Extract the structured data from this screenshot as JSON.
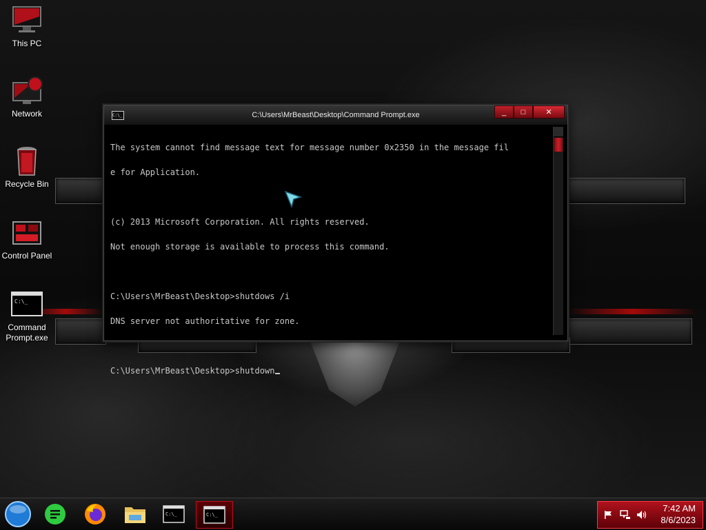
{
  "desktop": {
    "icons": [
      {
        "label": "This PC",
        "icon": "computer-icon"
      },
      {
        "label": "Network",
        "icon": "network-icon"
      },
      {
        "label": "Recycle Bin",
        "icon": "recycle-bin-icon"
      },
      {
        "label": "Control Panel",
        "icon": "control-panel-icon"
      },
      {
        "label": "Command Prompt.exe",
        "icon": "command-prompt-icon"
      }
    ]
  },
  "window": {
    "title": "C:\\Users\\MrBeast\\Desktop\\Command Prompt.exe",
    "icon_text": "C:\\_",
    "minimize_glyph": "_",
    "maximize_glyph": "□",
    "close_glyph": "✕",
    "console_lines": [
      "The system cannot find message text for message number 0x2350 in the message fil",
      "e for Application.",
      "",
      "(c) 2013 Microsoft Corporation. All rights reserved.",
      "Not enough storage is available to process this command.",
      "",
      "C:\\Users\\MrBeast\\Desktop>shutdows /i",
      "DNS server not authoritative for zone.",
      "",
      "C:\\Users\\MrBeast\\Desktop>shutdown"
    ]
  },
  "taskbar": {
    "items": [
      {
        "name": "start-orb",
        "icon": "start-orb-icon"
      },
      {
        "name": "notes-app",
        "icon": "notes-app-icon"
      },
      {
        "name": "firefox",
        "icon": "firefox-icon"
      },
      {
        "name": "file-explorer",
        "icon": "folder-icon"
      },
      {
        "name": "command-prompt-1",
        "icon": "command-prompt-icon",
        "text": "C:\\_"
      },
      {
        "name": "command-prompt-2",
        "icon": "command-prompt-icon",
        "text": "C:\\_",
        "active": true
      }
    ],
    "tray": {
      "time": "7:42 AM",
      "date": "8/6/2023",
      "icons": [
        "flag-icon",
        "network-icon",
        "volume-icon"
      ]
    }
  },
  "colors": {
    "accent": "#c0101c",
    "console_text": "#c8c8c8",
    "console_bg": "#000000"
  }
}
